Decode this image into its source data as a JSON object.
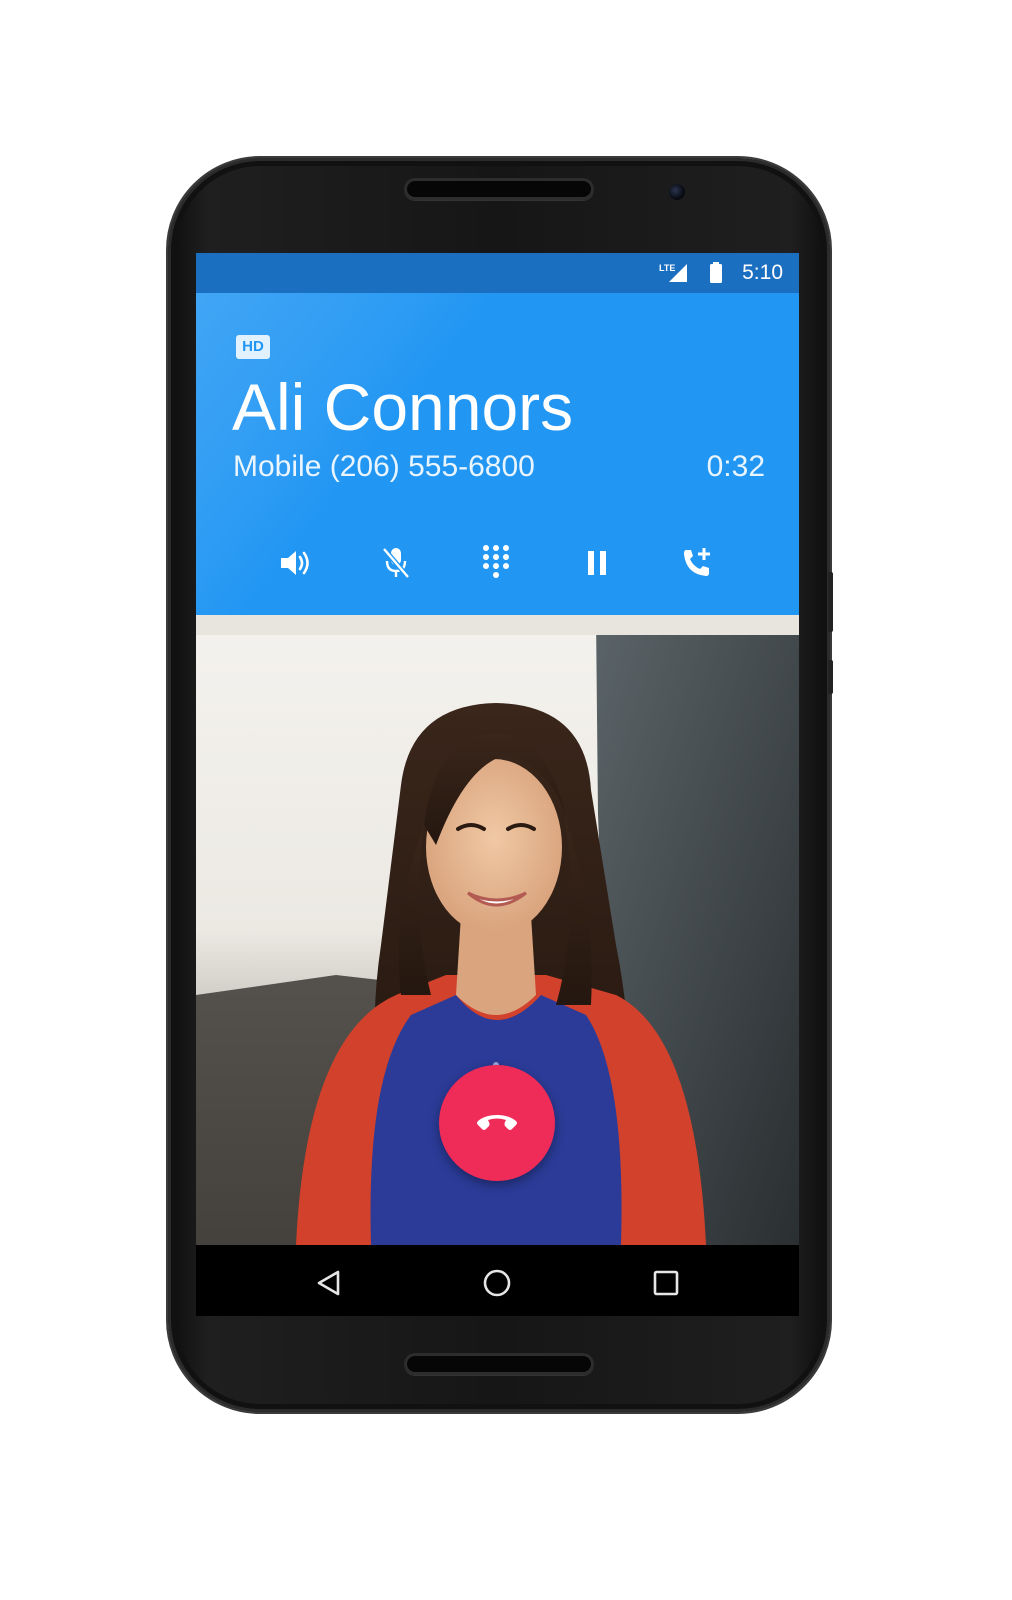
{
  "status_bar": {
    "network": "LTE",
    "time": "5:10",
    "signal_icon": "signal-icon",
    "battery_icon": "battery-icon"
  },
  "call": {
    "hd_badge": "HD",
    "contact_name": "Ali Connors",
    "contact_label": "Mobile (206) 555-6800",
    "duration": "0:32",
    "actions": [
      {
        "icon": "speaker-icon"
      },
      {
        "icon": "mute-mic-icon"
      },
      {
        "icon": "dialpad-icon"
      },
      {
        "icon": "pause-icon"
      },
      {
        "icon": "add-call-icon"
      }
    ],
    "end_call_icon": "end-call-icon"
  },
  "nav": {
    "back_icon": "back-icon",
    "home_icon": "home-icon",
    "recents_icon": "recents-icon"
  },
  "colors": {
    "header_blue": "#2196f3",
    "status_blue": "#1a6fc1",
    "end_call_red": "#ef2b57"
  }
}
